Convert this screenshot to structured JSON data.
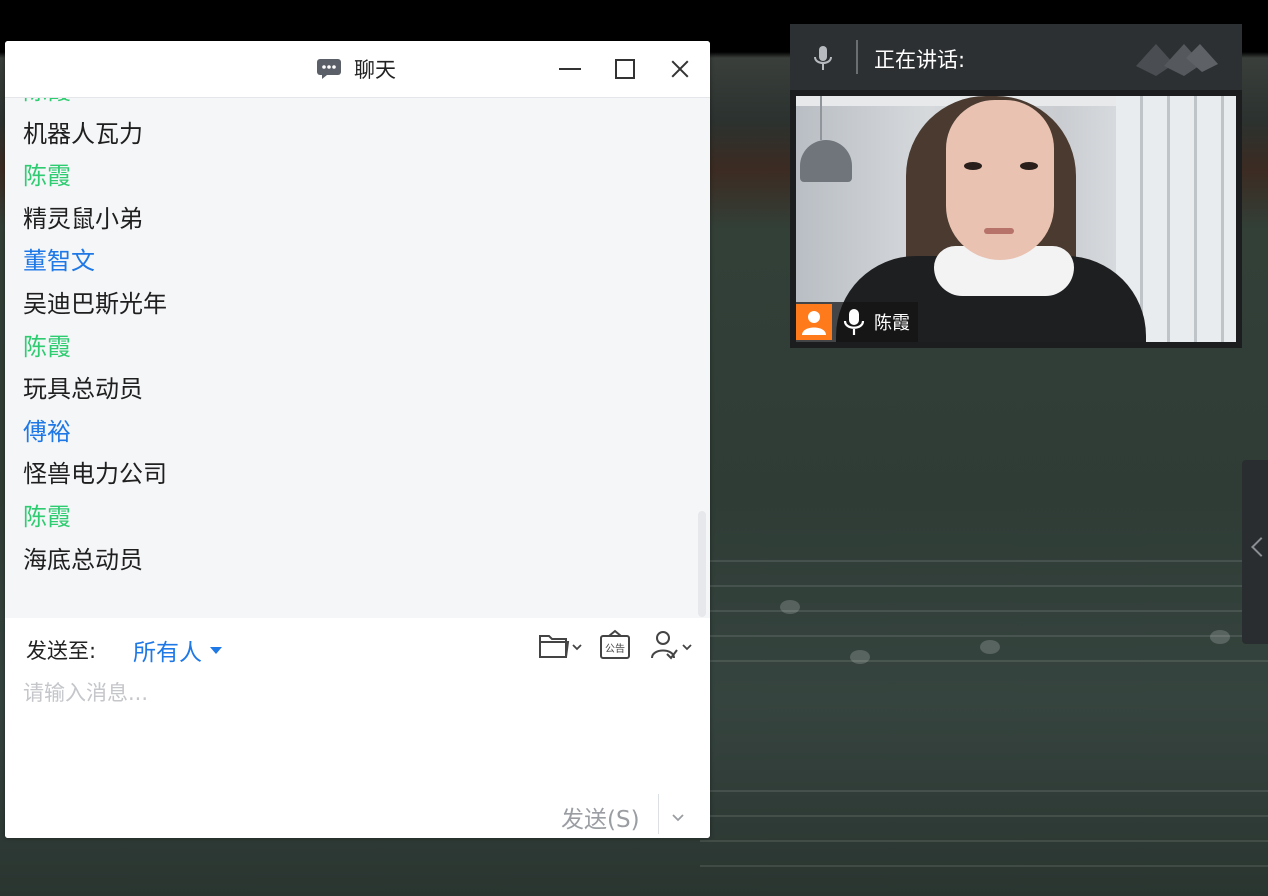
{
  "chat_window": {
    "title": "聊天",
    "messages": [
      {
        "kind": "name",
        "color": "green",
        "text": "陈霞"
      },
      {
        "kind": "text",
        "text": "机器人瓦力"
      },
      {
        "kind": "name",
        "color": "green",
        "text": "陈霞"
      },
      {
        "kind": "text",
        "text": "精灵鼠小弟"
      },
      {
        "kind": "name",
        "color": "blue",
        "text": "董智文"
      },
      {
        "kind": "text",
        "text": "吴迪巴斯光年"
      },
      {
        "kind": "name",
        "color": "green",
        "text": "陈霞"
      },
      {
        "kind": "text",
        "text": "玩具总动员"
      },
      {
        "kind": "name",
        "color": "blue",
        "text": "傅裕"
      },
      {
        "kind": "text",
        "text": "怪兽电力公司"
      },
      {
        "kind": "name",
        "color": "green",
        "text": "陈霞"
      },
      {
        "kind": "text",
        "text": "海底总动员"
      }
    ],
    "composer": {
      "send_to_label": "发送至:",
      "send_to_value": "所有人",
      "input_placeholder": "请输入消息...",
      "input_value": "",
      "send_button": "发送(S)"
    },
    "toolbar_icons": [
      "file-icon",
      "notice-icon",
      "assign-icon"
    ]
  },
  "speaker_panel": {
    "label": "正在讲话:",
    "speaker_name": "陈霞"
  },
  "colors": {
    "name_green": "#2ecc71",
    "name_blue": "#1e78e6",
    "accent_orange": "#ff7a1a",
    "panel_dark": "#2d3033"
  }
}
